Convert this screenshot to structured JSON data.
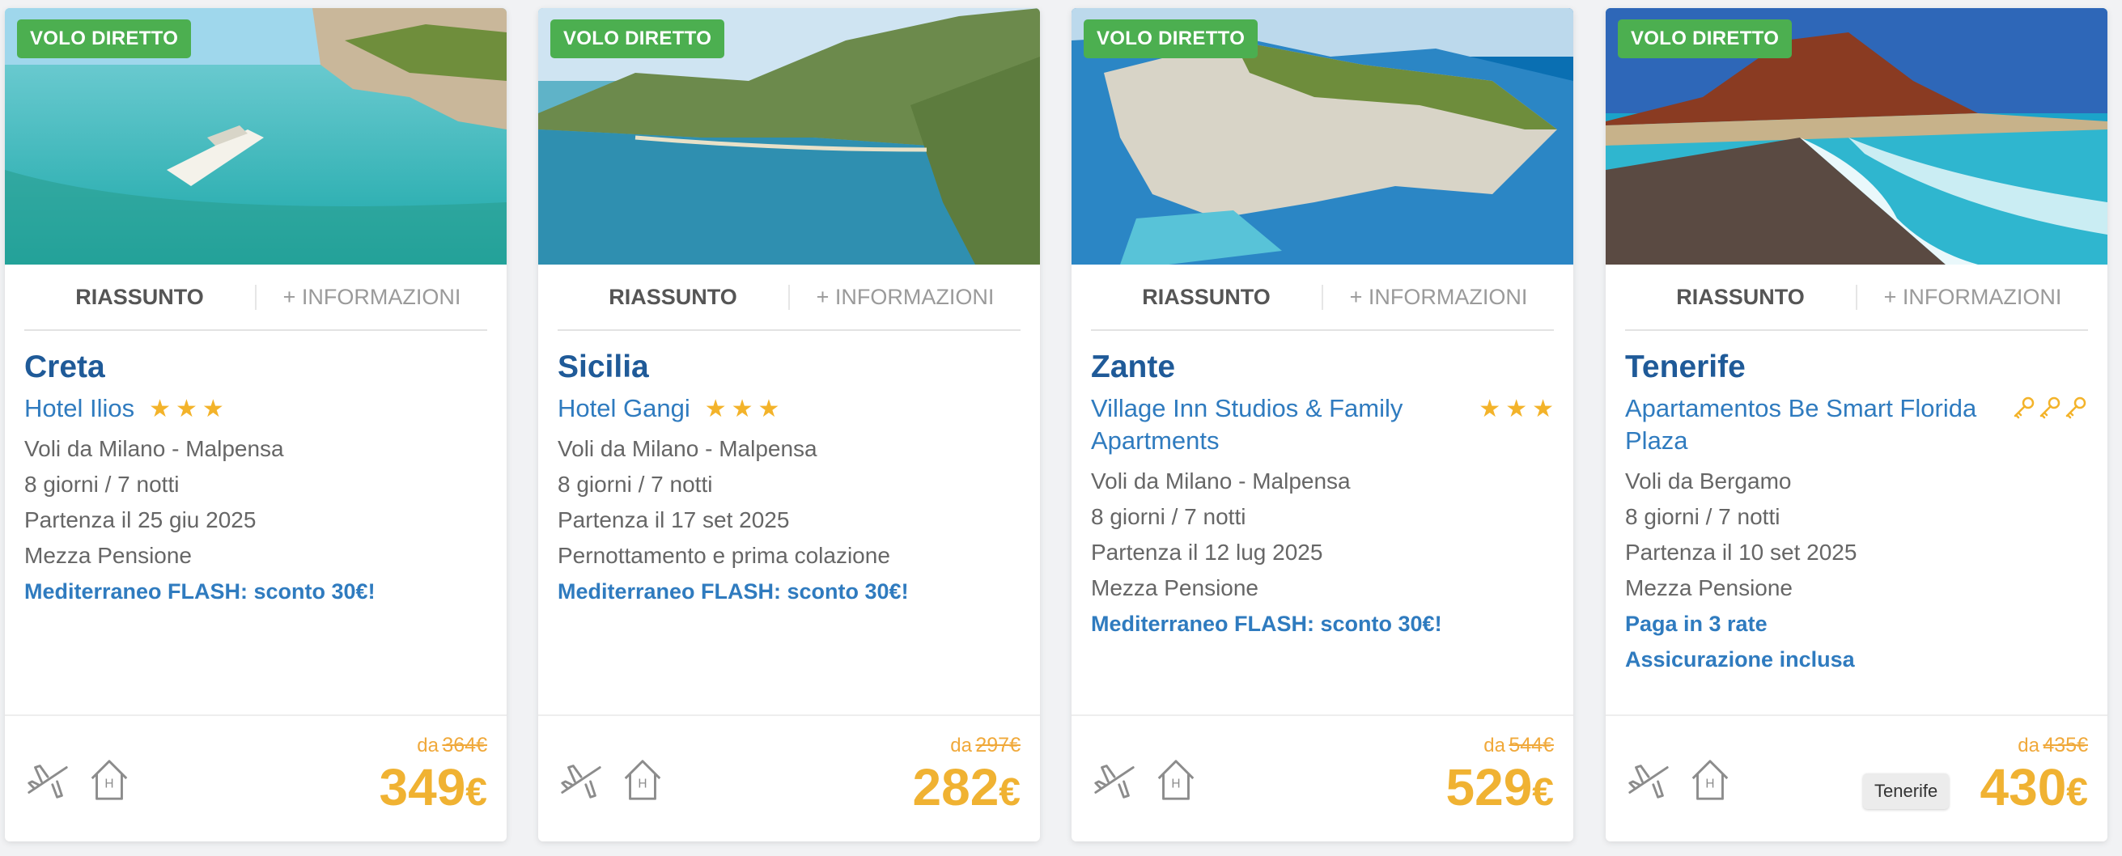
{
  "cards": [
    {
      "badge": "VOLO DIRETTO",
      "tab_summary": "RIASSUNTO",
      "tab_info": "+ INFORMAZIONI",
      "destination": "Creta",
      "hotel": "Hotel Ilios",
      "rating_icon": "star-icon",
      "rating_count": 3,
      "departure": "Voli da Milano - Malpensa",
      "duration": "8 giorni / 7 notti",
      "date": "Partenza il 25 giu 2025",
      "board": "Mezza Pensione",
      "promos": [
        "Mediterraneo FLASH: sconto 30€!"
      ],
      "price_prefix": "da",
      "old_price": "364€",
      "price": "349",
      "currency": "€"
    },
    {
      "badge": "VOLO DIRETTO",
      "tab_summary": "RIASSUNTO",
      "tab_info": "+ INFORMAZIONI",
      "destination": "Sicilia",
      "hotel": "Hotel Gangi",
      "rating_icon": "star-icon",
      "rating_count": 3,
      "departure": "Voli da Milano - Malpensa",
      "duration": "8 giorni / 7 notti",
      "date": "Partenza il 17 set 2025",
      "board": "Pernottamento e prima colazione",
      "promos": [
        "Mediterraneo FLASH: sconto 30€!"
      ],
      "price_prefix": "da",
      "old_price": "297€",
      "price": "282",
      "currency": "€"
    },
    {
      "badge": "VOLO DIRETTO",
      "tab_summary": "RIASSUNTO",
      "tab_info": "+ INFORMAZIONI",
      "destination": "Zante",
      "hotel": "Village Inn Studios & Family Apartments",
      "rating_icon": "star-icon",
      "rating_count": 3,
      "departure": "Voli da Milano - Malpensa",
      "duration": "8 giorni / 7 notti",
      "date": "Partenza il 12 lug 2025",
      "board": "Mezza Pensione",
      "promos": [
        "Mediterraneo FLASH: sconto 30€!"
      ],
      "price_prefix": "da",
      "old_price": "544€",
      "price": "529",
      "currency": "€"
    },
    {
      "badge": "VOLO DIRETTO",
      "tab_summary": "RIASSUNTO",
      "tab_info": "+ INFORMAZIONI",
      "destination": "Tenerife",
      "hotel": "Apartamentos Be Smart Florida Plaza",
      "rating_icon": "key-icon",
      "rating_count": 3,
      "departure": "Voli da Bergamo",
      "duration": "8 giorni / 7 notti",
      "date": "Partenza il 10 set 2025",
      "board": "Mezza Pensione",
      "promos": [
        "Paga in 3 rate",
        "Assicurazione inclusa"
      ],
      "price_prefix": "da",
      "old_price": "435€",
      "price": "430",
      "currency": "€"
    }
  ],
  "tooltip": "Tenerife",
  "colors": {
    "badge": "#4caf50",
    "title": "#1f5a98",
    "link": "#2f7bbf",
    "price": "#f0b232",
    "star": "#f3b32a"
  },
  "footer_icons": [
    "plane-icon",
    "house-icon"
  ]
}
